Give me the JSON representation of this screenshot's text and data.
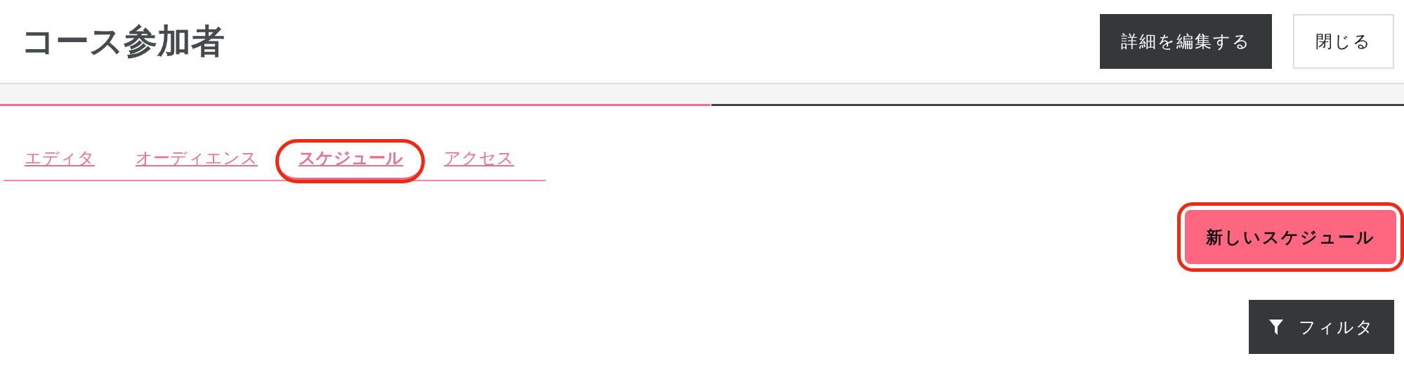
{
  "header": {
    "title": "コース参加者",
    "buttons": [
      {
        "label": "詳細を編集する",
        "kind": "primary"
      },
      {
        "label": "閉じる",
        "kind": "secondary"
      }
    ]
  },
  "progress": {
    "level": 0.506
  },
  "tabs": [
    {
      "label": "エディタ",
      "selected": false,
      "annotated": false
    },
    {
      "label": "オーディエンス",
      "selected": false,
      "annotated": false
    },
    {
      "label": "スケジュール",
      "selected": true,
      "annotated": true
    },
    {
      "label": "アクセス",
      "selected": false,
      "annotated": false
    }
  ],
  "new_schedule_button": {
    "label": "新しいスケジュール",
    "annotated": true
  },
  "filter_button": {
    "label": "フィルタ"
  }
}
